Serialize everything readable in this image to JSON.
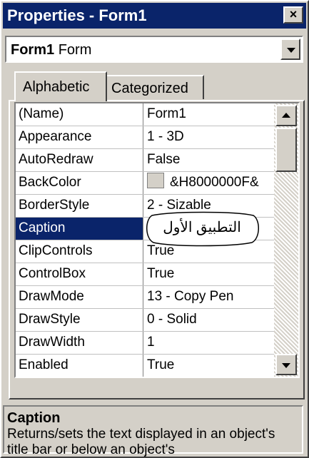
{
  "window": {
    "title": "Properties - Form1",
    "close_glyph": "×"
  },
  "object_selector": {
    "name": "Form1",
    "type": "Form"
  },
  "tabs": [
    {
      "label": "Alphabetic"
    },
    {
      "label": "Categorized"
    }
  ],
  "properties": [
    {
      "name": "(Name)",
      "value": "Form1"
    },
    {
      "name": "Appearance",
      "value": "1 - 3D"
    },
    {
      "name": "AutoRedraw",
      "value": "False"
    },
    {
      "name": "BackColor",
      "value": "&H8000000F&"
    },
    {
      "name": "BorderStyle",
      "value": "2 - Sizable"
    },
    {
      "name": "Caption",
      "value": ""
    },
    {
      "name": "ClipControls",
      "value": "True"
    },
    {
      "name": "ControlBox",
      "value": "True"
    },
    {
      "name": "DrawMode",
      "value": "13 - Copy Pen"
    },
    {
      "name": "DrawStyle",
      "value": "0 - Solid"
    },
    {
      "name": "DrawWidth",
      "value": "1"
    },
    {
      "name": "Enabled",
      "value": "True"
    }
  ],
  "caption_annotation": "التطبيق الأول",
  "description": {
    "title": "Caption",
    "text": "Returns/sets the text displayed in an object's title bar or below an object's"
  },
  "colors": {
    "selection": "#0a246a",
    "face": "#d4d0c8",
    "backcolor_swatch": "#d4d0c8"
  }
}
